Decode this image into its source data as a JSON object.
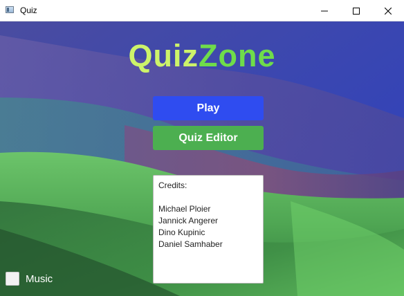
{
  "window": {
    "title": "Quiz",
    "controls": [
      "minimize-icon",
      "maximize-icon",
      "close-icon"
    ]
  },
  "logo": {
    "part1": "Quiz",
    "part2": "Zone"
  },
  "buttons": {
    "play": "Play",
    "editor": "Quiz Editor"
  },
  "credits": {
    "heading": "Credits:",
    "names": [
      "Michael Ploier",
      "Jannick Angerer",
      "Dino Kupinic",
      "Daniel Samhaber"
    ]
  },
  "music": {
    "label": "Music",
    "checked": false
  },
  "colors": {
    "play_button": "#2f4cf0",
    "editor_button": "#4caf50",
    "logo_quiz": "#cdf36a",
    "logo_zone": "#6fdc4a"
  }
}
